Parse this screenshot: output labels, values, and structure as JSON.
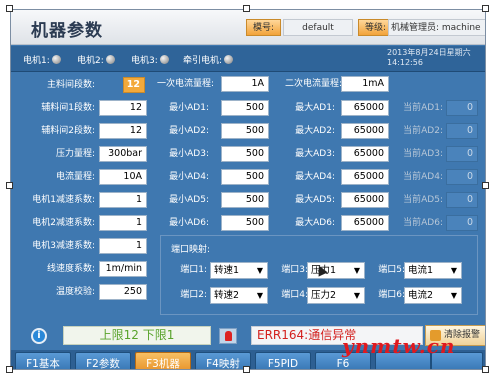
{
  "header": {
    "title": "机器参数",
    "model_label": "模号:",
    "model_value": "default",
    "level_label": "等级:",
    "level_value": "机械管理员: machine"
  },
  "status": {
    "motors": [
      "电机1:",
      "电机2:",
      "电机3:",
      "牵引电机:"
    ],
    "date": "2013年8月24日星期六",
    "time": "14:12:56"
  },
  "left_params": [
    {
      "label": "主料间段数:",
      "value": "12"
    },
    {
      "label": "辅料间1段数:",
      "value": "12"
    },
    {
      "label": "辅料间2段数:",
      "value": "12"
    },
    {
      "label": "压力量程:",
      "value": "300bar"
    },
    {
      "label": "电流量程:",
      "value": "10A"
    },
    {
      "label": "电机1减速系数:",
      "value": "1"
    },
    {
      "label": "电机2减速系数:",
      "value": "1"
    },
    {
      "label": "电机3减速系数:",
      "value": "1"
    },
    {
      "label": "线速度系数:",
      "value": "1m/min"
    },
    {
      "label": "温度校验:",
      "value": "250"
    }
  ],
  "range": {
    "primary_label": "一次电流量程:",
    "primary_value": "1A",
    "secondary_label": "二次电流量程:",
    "secondary_value": "1mA"
  },
  "ad_rows": [
    {
      "min_label": "最小AD1:",
      "min": "500",
      "max_label": "最大AD1:",
      "max": "65000",
      "cur_label": "当前AD1:",
      "cur": "0"
    },
    {
      "min_label": "最小AD2:",
      "min": "500",
      "max_label": "最大AD2:",
      "max": "65000",
      "cur_label": "当前AD2:",
      "cur": "0"
    },
    {
      "min_label": "最小AD3:",
      "min": "500",
      "max_label": "最大AD3:",
      "max": "65000",
      "cur_label": "当前AD3:",
      "cur": "0"
    },
    {
      "min_label": "最小AD4:",
      "min": "500",
      "max_label": "最大AD4:",
      "max": "65000",
      "cur_label": "当前AD4:",
      "cur": "0"
    },
    {
      "min_label": "最小AD5:",
      "min": "500",
      "max_label": "最大AD5:",
      "max": "65000",
      "cur_label": "当前AD5:",
      "cur": "0"
    },
    {
      "min_label": "最小AD6:",
      "min": "500",
      "max_label": "最大AD6:",
      "max": "65000",
      "cur_label": "当前AD6:",
      "cur": "0"
    }
  ],
  "mapping": {
    "title": "端口映射:",
    "ports": [
      {
        "label": "端口1:",
        "value": "转速1"
      },
      {
        "label": "端口3:",
        "value": "压力1"
      },
      {
        "label": "端口5:",
        "value": "电流1"
      },
      {
        "label": "端口2:",
        "value": "转速2"
      },
      {
        "label": "端口4:",
        "value": "压力2"
      },
      {
        "label": "端口6:",
        "value": "电流2"
      }
    ]
  },
  "footer": {
    "info_icon": "i",
    "limits": "上限12 下限1",
    "error": "ERR164:通信异常",
    "clear_label": "清除报警"
  },
  "tabs": [
    {
      "label": "F1基本"
    },
    {
      "label": "F2参数"
    },
    {
      "label": "F3机器"
    },
    {
      "label": "F4映射"
    },
    {
      "label": "F5PID"
    },
    {
      "label": "F6"
    },
    {
      "label": ""
    },
    {
      "label": ""
    }
  ],
  "active_tab": "F3机器",
  "watermark": "ynmtw.cn",
  "colors": {
    "panel": "#3f78b0",
    "highlight": "#f3a93a",
    "error": "#d3201e",
    "limits": "#59a32b"
  }
}
